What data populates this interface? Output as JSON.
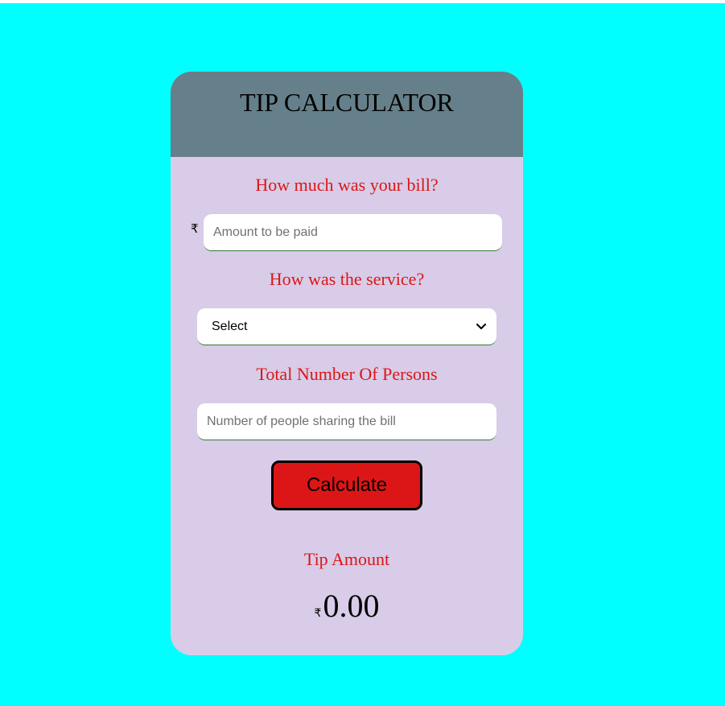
{
  "header": {
    "title": "TIP CALCULATOR"
  },
  "bill": {
    "label": "How much was your bill?",
    "currency_symbol": "₹",
    "value": "",
    "placeholder": "Amount to be paid"
  },
  "service": {
    "label": "How was the service?",
    "selected": "Select"
  },
  "persons": {
    "label": "Total Number Of Persons",
    "value": "",
    "placeholder": "Number of people sharing the bill"
  },
  "calculate_label": "Calculate",
  "result": {
    "label": "Tip Amount",
    "currency_symbol": "₹",
    "amount": "0.00"
  },
  "colors": {
    "page_background": "#00ffff",
    "card_background": "#d8cce8",
    "header_background": "#65808a",
    "label_text": "#dc1616",
    "button_background": "#dc1616"
  },
  "icons": {
    "dropdown": "chevron-down-icon"
  }
}
